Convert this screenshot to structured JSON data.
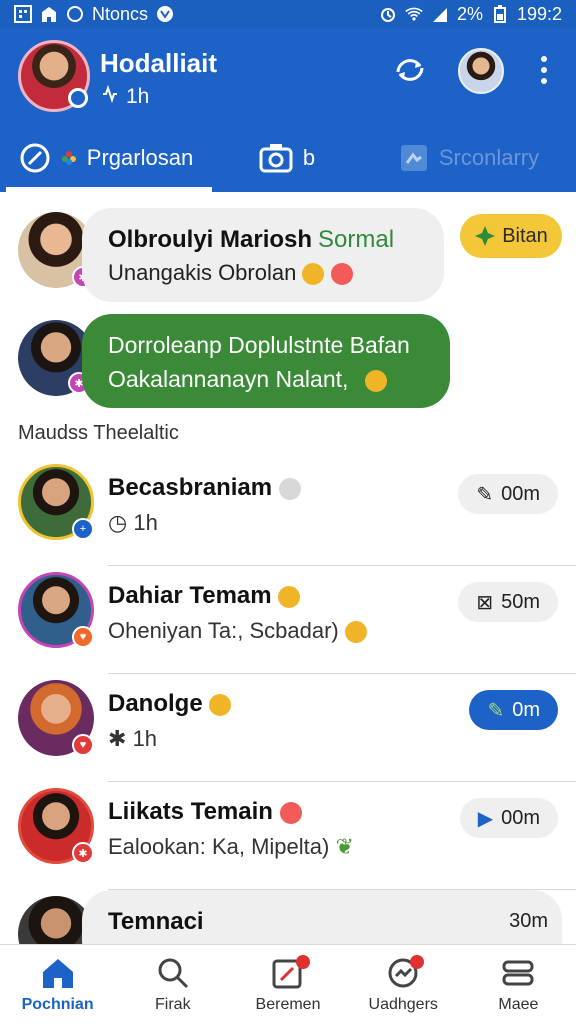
{
  "status_bar": {
    "notice": "Ntoncs",
    "battery": "2%",
    "time": "199:2"
  },
  "header": {
    "name": "Hodalliait",
    "sub": "1h",
    "tabs": [
      {
        "label": "Prgarlosan",
        "active": true
      },
      {
        "label": "b"
      },
      {
        "label": "Srconlarry"
      }
    ]
  },
  "pinned": [
    {
      "title": "Olbroulyi Mariosh",
      "tag": "Sormal",
      "line": "Unangakis Obrolan",
      "action": "Bitan"
    },
    {
      "line1": "Dorroleanp Doplulstnte Bafan",
      "line2": "Oakalannanayn Nalant,"
    }
  ],
  "section_title": "Maudss Theelaltic",
  "conversations": [
    {
      "name": "Becasbraniam",
      "sub": "1h",
      "time": "00m"
    },
    {
      "name": "Dahiar Temam",
      "sub": "Oheniyan Ta:, Scbadar)",
      "time": "50m"
    },
    {
      "name": "Danolge",
      "sub": "1h",
      "time": "0m"
    },
    {
      "name": "Liikats Temain",
      "sub": "Ealookan: Ka, Mipelta)",
      "time": "00m"
    },
    {
      "name": "Temnaci",
      "time": "30m"
    }
  ],
  "bottom_nav": [
    {
      "label": "Pochnian",
      "active": true
    },
    {
      "label": "Firak"
    },
    {
      "label": "Beremen"
    },
    {
      "label": "Uadhgers"
    },
    {
      "label": "Maee"
    }
  ],
  "colors": {
    "brand": "#1d62c6",
    "green": "#3a8a38",
    "yellow": "#f4c739"
  }
}
